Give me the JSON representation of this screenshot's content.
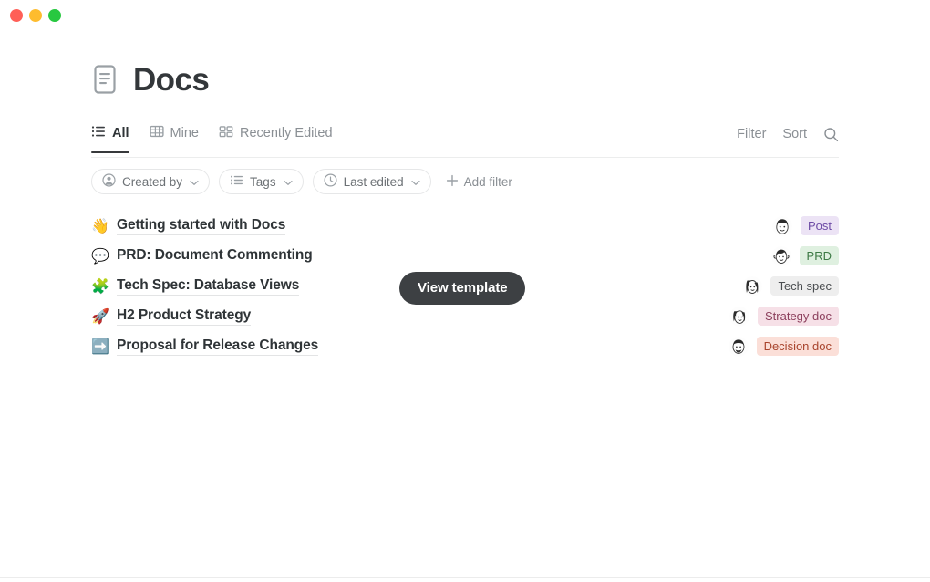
{
  "window": {
    "traffic_lights": [
      {
        "name": "close",
        "color": "#ff5f57"
      },
      {
        "name": "minimize",
        "color": "#febc2e"
      },
      {
        "name": "zoom",
        "color": "#28c840"
      }
    ]
  },
  "header": {
    "icon": "document-icon",
    "title": "Docs"
  },
  "tabs": [
    {
      "id": "all",
      "label": "All",
      "icon": "list-view-icon",
      "active": true
    },
    {
      "id": "mine",
      "label": "Mine",
      "icon": "table-view-icon",
      "active": false
    },
    {
      "id": "recently-edited",
      "label": "Recently Edited",
      "icon": "gallery-view-icon",
      "active": false
    }
  ],
  "tab_actions": {
    "filter_label": "Filter",
    "sort_label": "Sort",
    "search_icon": "search-icon"
  },
  "filters": {
    "chips": [
      {
        "id": "created-by",
        "label": "Created by",
        "icon": "person-icon",
        "chevron": "chevron-down-icon"
      },
      {
        "id": "tags",
        "label": "Tags",
        "icon": "list-icon",
        "chevron": "chevron-down-icon"
      },
      {
        "id": "last-edited",
        "label": "Last edited",
        "icon": "clock-icon",
        "chevron": "chevron-down-icon"
      }
    ],
    "add_filter_label": "Add filter",
    "add_filter_icon": "plus-icon"
  },
  "documents": [
    {
      "emoji": "👋",
      "emoji_name": "waving-hand-emoji",
      "title": "Getting started with Docs",
      "badge": "Post",
      "badge_bg": "#ece3f5",
      "badge_color": "#6c4aa5",
      "avatar": "avatar-short-dark-hair"
    },
    {
      "emoji": "💬",
      "emoji_name": "speech-balloon-emoji",
      "title": "PRD: Document Commenting",
      "badge": "PRD",
      "badge_bg": "#dff0e0",
      "badge_color": "#3d7a45",
      "avatar": "avatar-headphones"
    },
    {
      "emoji": "🧩",
      "emoji_name": "puzzle-piece-emoji",
      "title": "Tech Spec: Database Views",
      "badge": "Tech spec",
      "badge_bg": "#eeeeee",
      "badge_color": "#4a4d50",
      "avatar": "avatar-long-dark-hair"
    },
    {
      "emoji": "🚀",
      "emoji_name": "rocket-emoji",
      "title": "H2 Product Strategy",
      "badge": "Strategy doc",
      "badge_bg": "#f6e0e7",
      "badge_color": "#8c3f5c",
      "avatar": "avatar-bob-dark-hair"
    },
    {
      "emoji": "➡️",
      "emoji_name": "right-arrow-emoji",
      "title": "Proposal for Release Changes",
      "badge": "Decision doc",
      "badge_bg": "#fbdfd8",
      "badge_color": "#a8442d",
      "avatar": "avatar-beard"
    }
  ],
  "overlay": {
    "view_template_label": "View template"
  }
}
